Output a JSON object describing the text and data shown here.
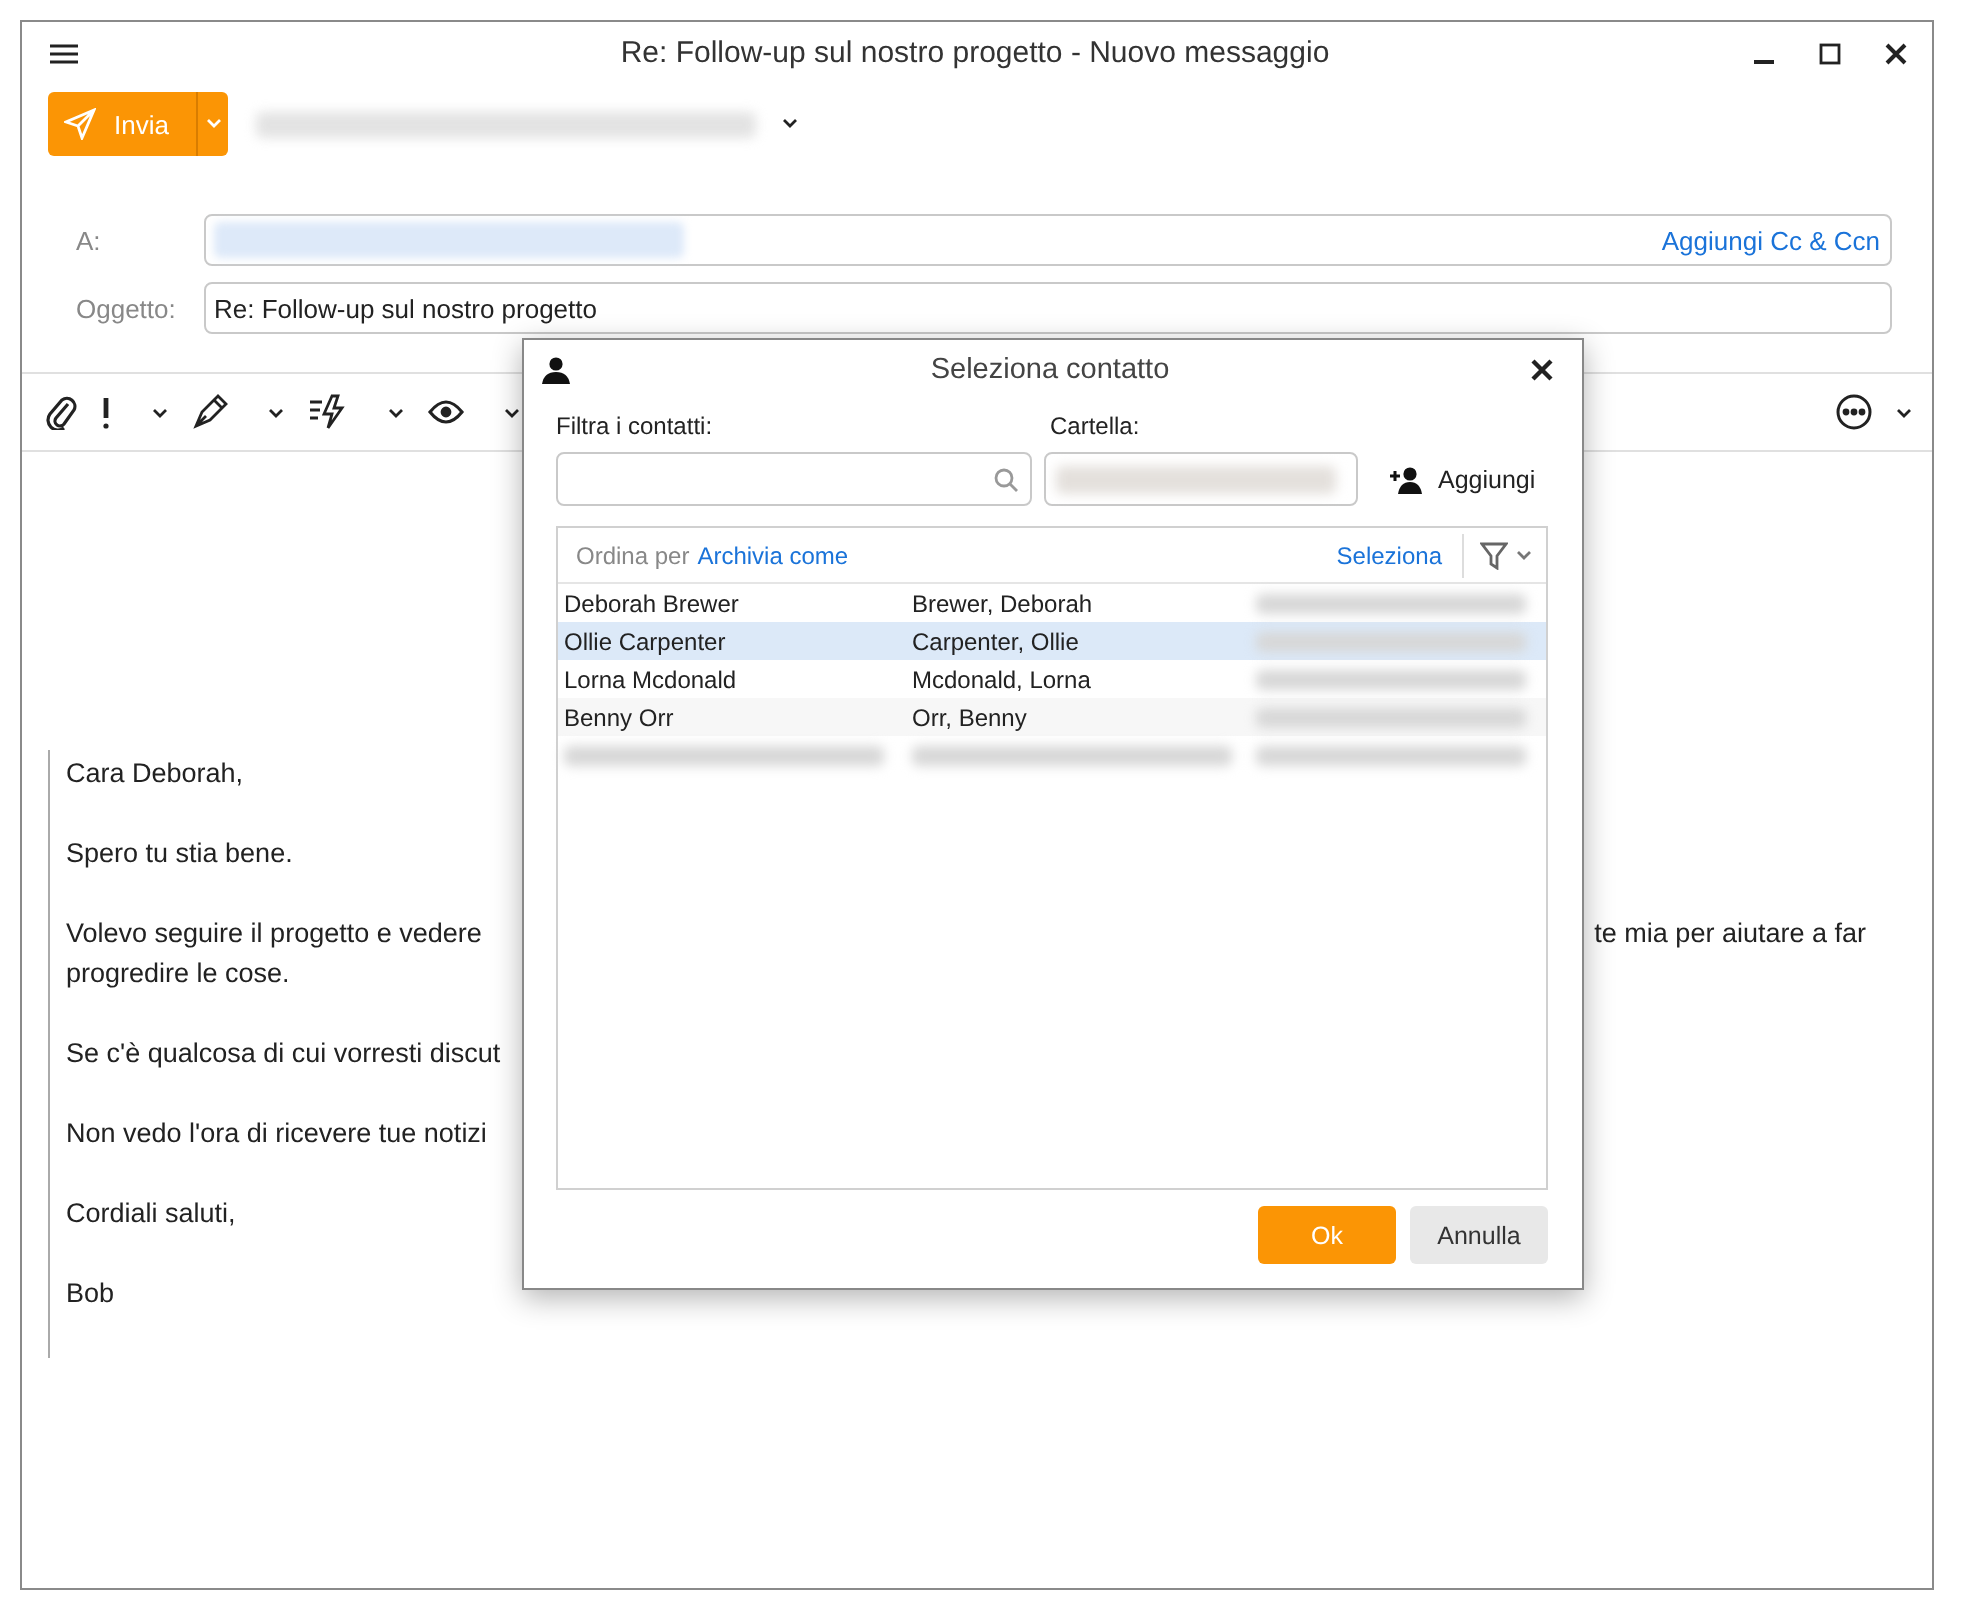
{
  "window": {
    "title": "Re: Follow-up sul nostro progetto - Nuovo messaggio"
  },
  "toolbar": {
    "send_label": "Invia"
  },
  "fields": {
    "to_label": "A:",
    "cc_link": "Aggiungi Cc & Ccn",
    "subject_label": "Oggetto:",
    "subject_value": "Re: Follow-up sul nostro progetto"
  },
  "body": [
    {
      "left": "Cara Deborah,"
    },
    {
      "left": "Spero tu stia bene."
    },
    {
      "left": "Volevo seguire il progetto e vedere",
      "right": "te mia per aiutare a far",
      "continuation": "progredire le cose."
    },
    {
      "left": "Se c'è qualcosa di cui vorresti discut"
    },
    {
      "left": "Non vedo l'ora di ricevere tue notizi"
    },
    {
      "left": "Cordiali saluti,"
    },
    {
      "left": "Bob"
    }
  ],
  "dialog": {
    "title": "Seleziona contatto",
    "filter_label": "Filtra i contatti:",
    "folder_label": "Cartella:",
    "add_button": "Aggiungi",
    "sort_label": "Ordina per",
    "sort_value": "Archivia come",
    "select_link": "Seleziona",
    "rows": [
      {
        "kind": "contact",
        "name": "Deborah Brewer",
        "file_as": "Brewer, Deborah",
        "selected": false
      },
      {
        "kind": "contact",
        "name": "Ollie Carpenter",
        "file_as": "Carpenter, Ollie",
        "selected": true
      },
      {
        "kind": "contact",
        "name": "Lorna Mcdonald",
        "file_as": "Mcdonald, Lorna",
        "selected": false
      },
      {
        "kind": "contact",
        "name": "Benny Orr",
        "file_as": "Orr, Benny",
        "selected": false
      },
      {
        "kind": "redacted",
        "selected": false
      }
    ],
    "ok": "Ok",
    "cancel": "Annulla"
  }
}
